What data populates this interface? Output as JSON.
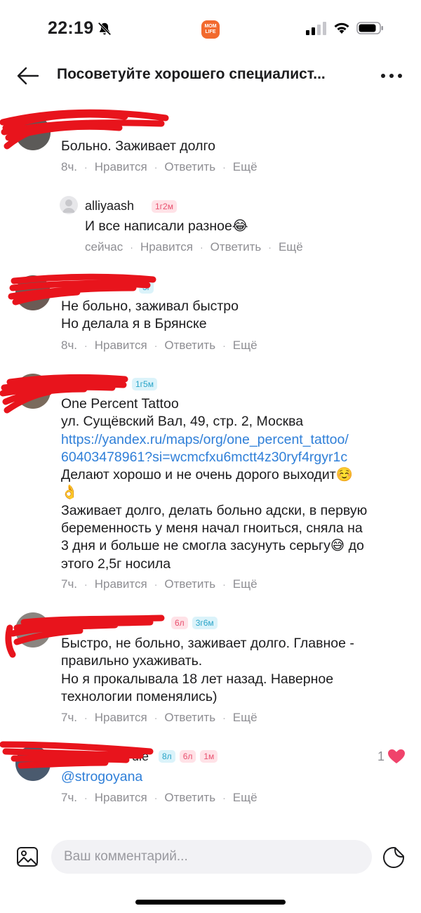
{
  "status_bar": {
    "time": "22:19",
    "app_logo_text": "MOM LIFE"
  },
  "header": {
    "title": "Посоветуйте хорошего специалист..."
  },
  "actions": {
    "like": "Нравится",
    "reply": "Ответить",
    "more": "Ещё",
    "separator": "·"
  },
  "comments": [
    {
      "username": "",
      "badges": [],
      "text": [
        "Больно. Заживает долго"
      ],
      "time": "8ч."
    },
    {
      "username": "alliyaash",
      "badges": [
        "1г2м"
      ],
      "text": [
        "И все написали разное😂"
      ],
      "time": "сейчас",
      "reply": true
    },
    {
      "username": "",
      "badges": [
        "3г"
      ],
      "text": [
        "Не больно, заживал быстро",
        "Но делала я в Брянске"
      ],
      "time": "8ч."
    },
    {
      "username": "",
      "badges": [
        "1г5м"
      ],
      "text": [
        "One Percent Tattoo",
        "ул. Сущёвский Вал, 49, стр. 2, Москва",
        "https://yandex.ru/maps/org/one_percent_tattoo/",
        "60403478961?si=wcmcfxu6mctt4z30ryf4rgyr1c",
        "Делают хорошо и не очень дорого выходит☺️",
        "👌",
        "Заживает долго, делать больно адски, в первую",
        "беременность у меня начал гноиться, сняла на",
        "3 дня и больше не смогла засунуть серьгу😅 до",
        "этого 2,5г носила"
      ],
      "time": "7ч."
    },
    {
      "username": "",
      "badges": [
        "6л",
        "3г6м"
      ],
      "text": [
        "Быстро, не больно, заживает долго. Главное -",
        "правильно ухаживать.",
        "Но я прокалывала 18 лет назад. Наверное",
        "технологии поменялись)"
      ],
      "time": "7ч."
    },
    {
      "username": "die",
      "badges": [
        "8л",
        "6л",
        "1м"
      ],
      "text": [
        "@strogoyana"
      ],
      "time": "7ч.",
      "likes": "1"
    }
  ],
  "composer": {
    "placeholder": "Ваш комментарий..."
  },
  "colors": {
    "accent_link": "#2f7fd8",
    "meta_gray": "#8e8e93",
    "like_heart": "#f0436b",
    "redaction": "#e8141c"
  }
}
